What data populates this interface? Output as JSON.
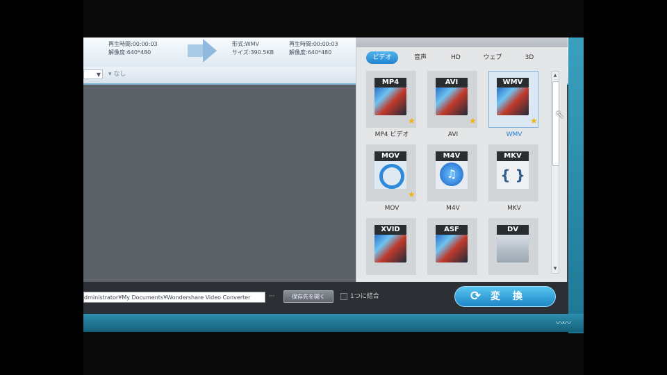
{
  "info": {
    "left_duration": "再生時間:00:00:03",
    "left_resolution": "解像度:640*480",
    "format": "形式:WMV",
    "size": "サイズ:390.5KB",
    "right_duration": "再生時間:00:00:03",
    "right_resolution": "解像度:640*480"
  },
  "subtitle": {
    "dropdown_value": "▼",
    "label": "なし"
  },
  "format_panel": {
    "tabs": [
      {
        "label": "ビデオ",
        "active": true
      },
      {
        "label": "音声",
        "active": false
      },
      {
        "label": "HD",
        "active": false
      },
      {
        "label": "ウェブ",
        "active": false
      },
      {
        "label": "3D",
        "active": false
      }
    ],
    "formats": [
      {
        "badge": "MP4",
        "caption": "MP4 ビデオ",
        "icon": "film-icon",
        "star": true,
        "selected": false
      },
      {
        "badge": "AVI",
        "caption": "AVI",
        "icon": "film-icon",
        "star": true,
        "selected": false
      },
      {
        "badge": "WMV",
        "caption": "WMV",
        "icon": "film-icon",
        "star": true,
        "selected": true
      },
      {
        "badge": "MOV",
        "caption": "MOV",
        "icon": "quicktime-icon",
        "star": true,
        "selected": false
      },
      {
        "badge": "M4V",
        "caption": "M4V",
        "icon": "itunes-icon",
        "star": false,
        "selected": false
      },
      {
        "badge": "MKV",
        "caption": "MKV",
        "icon": "matroska-icon",
        "star": false,
        "selected": false
      },
      {
        "badge": "XVID",
        "caption": "",
        "icon": "film-icon",
        "star": false,
        "selected": false
      },
      {
        "badge": "ASF",
        "caption": "",
        "icon": "film-icon",
        "star": false,
        "selected": false
      },
      {
        "badge": "DV",
        "caption": "",
        "icon": "camcorder-icon",
        "star": false,
        "selected": false
      }
    ]
  },
  "output": {
    "path": "dministrator¥My Documents¥Wondershare Video Converter",
    "browse_label": "···",
    "open_folder_label": "保存先を開く",
    "merge_label": "1つに結合"
  },
  "convert": {
    "icon": "refresh-icon",
    "label": "変換"
  },
  "colors": {
    "accent": "#1e86c8",
    "selected_text": "#1f7fd1",
    "star": "#f2b310"
  }
}
